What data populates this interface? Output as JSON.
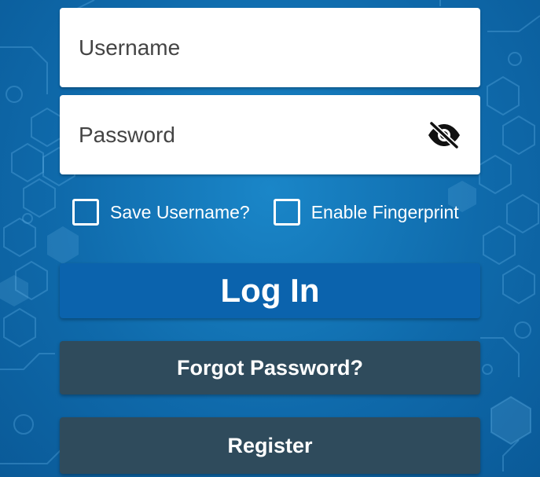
{
  "form": {
    "username_placeholder": "Username",
    "password_placeholder": "Password",
    "save_username_label": "Save Username?",
    "enable_fingerprint_label": "Enable Fingerprint",
    "login_label": "Log In",
    "forgot_password_label": "Forgot Password?",
    "register_label": "Register"
  },
  "icons": {
    "password_toggle": "eye-slash-icon"
  },
  "colors": {
    "background": "#1173b6",
    "login_button": "#0b63ad",
    "secondary_button": "#2f4b5c",
    "field": "#ffffff",
    "text_on_dark": "#ffffff"
  }
}
